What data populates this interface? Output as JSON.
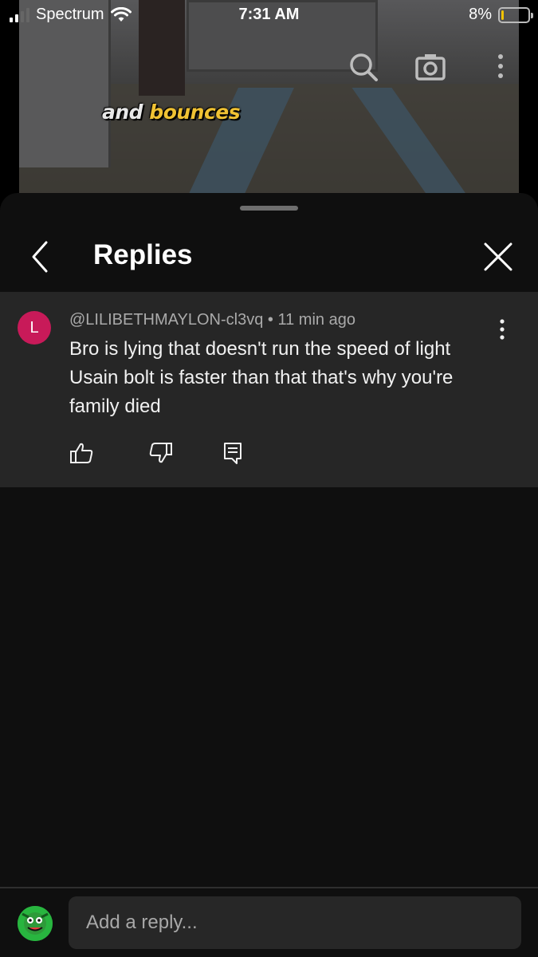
{
  "status_bar": {
    "carrier": "Spectrum",
    "time": "7:31 AM",
    "battery_text": "8%",
    "battery_level": 0.08,
    "battery_color": "#f2c300",
    "icons": [
      "signal-icon",
      "wifi-icon",
      "battery-icon"
    ]
  },
  "video": {
    "caption_word_1": "and",
    "caption_word_2": "bounces",
    "caption_accent_color": "#f0c233",
    "icons": [
      "search-icon",
      "camera-icon",
      "more-vertical-icon"
    ]
  },
  "sheet": {
    "title": "Replies",
    "icons": [
      "chevron-left-icon",
      "close-icon"
    ]
  },
  "comment": {
    "avatar_letter": "L",
    "avatar_color": "#c81a59",
    "author": "@LILIBETHMAYLON-cl3vq",
    "separator": " • ",
    "age": "11 min ago",
    "text": "Bro is lying that doesn't run the speed of light Usain bolt is faster than that that's why you're family died",
    "icons": [
      "thumbs-up-icon",
      "thumbs-down-icon",
      "reply-icon",
      "more-vertical-icon"
    ]
  },
  "reply_box": {
    "placeholder": "Add a reply...",
    "value": ""
  }
}
